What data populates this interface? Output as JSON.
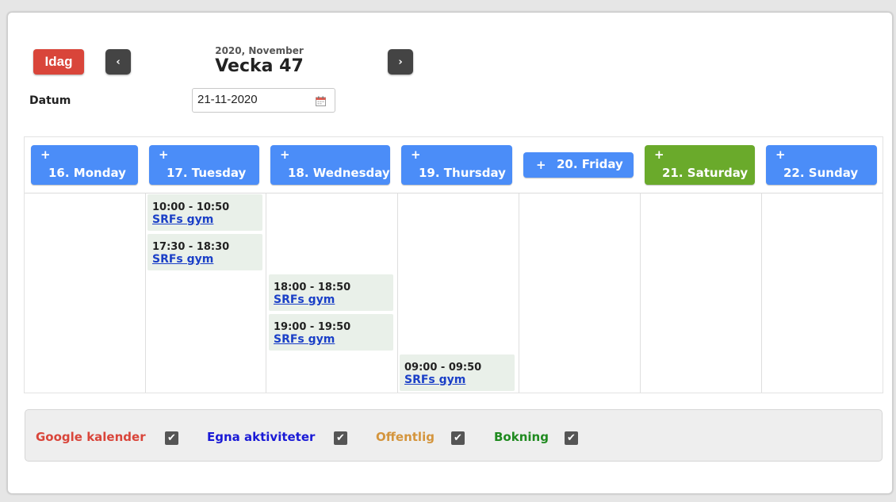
{
  "toolbar": {
    "today_label": "Idag",
    "prev_glyph": "‹",
    "next_glyph": "›",
    "month_label": "2020, November",
    "week_label": "Vecka 47",
    "datum_label": "Datum",
    "date_value": "21-11-2020",
    "today_color": "#d9453a"
  },
  "days": [
    {
      "plus": "+",
      "label": "16. Monday"
    },
    {
      "plus": "+",
      "label": "17. Tuesday"
    },
    {
      "plus": "+",
      "label": "18. Wednesday"
    },
    {
      "plus": "+",
      "label": "19. Thursday"
    },
    {
      "plus": "+",
      "label": "20. Friday"
    },
    {
      "plus": "+",
      "label": "21. Saturday"
    },
    {
      "plus": "+",
      "label": "22. Sunday"
    }
  ],
  "day_color": "#4b8df8",
  "selected_day_color": "#6aaa2b",
  "events": [
    {
      "day": "17. Tuesday",
      "time": "10:00 - 10:50",
      "title": "SRFs gym"
    },
    {
      "day": "17. Tuesday",
      "time": "17:30 - 18:30",
      "title": "SRFs gym"
    },
    {
      "day": "18. Wednesday",
      "time": "18:00 - 18:50",
      "title": "SRFs gym"
    },
    {
      "day": "18. Wednesday",
      "time": "19:00 - 19:50",
      "title": "SRFs gym"
    },
    {
      "day": "19. Thursday",
      "time": "09:00 - 09:50",
      "title": "SRFs gym"
    }
  ],
  "legend": [
    {
      "label": "Google kalender",
      "color": "#d9453a",
      "checked": true
    },
    {
      "label": "Egna aktiviteter",
      "color": "#1a1ad6",
      "checked": true
    },
    {
      "label": "Offentlig",
      "color": "#d4953d",
      "checked": true
    },
    {
      "label": "Bokning",
      "color": "#1f8a1f",
      "checked": true
    }
  ],
  "icons": {
    "calendar": "calendar-icon",
    "check": "checkmark-icon"
  }
}
